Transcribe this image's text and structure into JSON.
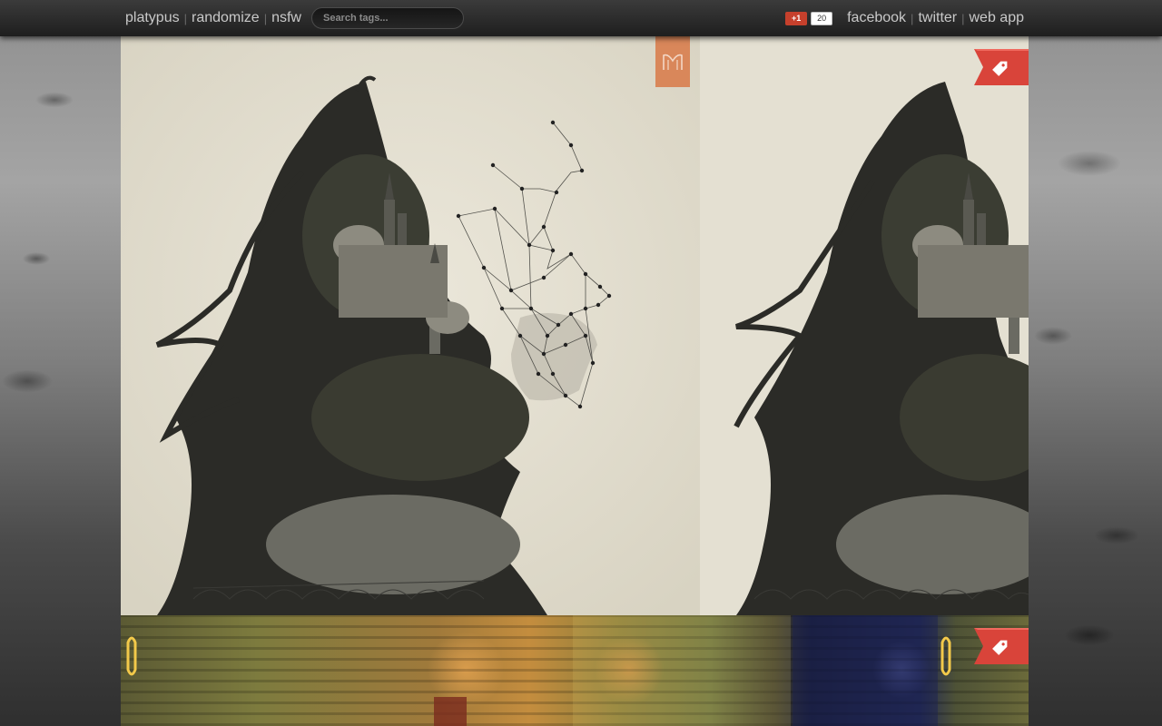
{
  "nav": {
    "brand": "platypus",
    "randomize": "randomize",
    "nsfw": "nsfw",
    "separator": "|",
    "search_placeholder": "Search tags..."
  },
  "social": {
    "gplus_label": "+1",
    "gplus_count": "20",
    "facebook": "facebook",
    "twitter": "twitter",
    "web_app": "web app"
  },
  "icons": {
    "logo": "m-logo-icon",
    "tag": "tag-icon"
  },
  "colors": {
    "accent_orange": "#d9875a",
    "ribbon_red": "#d9443a",
    "gplus_red": "#c6402c",
    "topbar": "#2a2a2a",
    "paper": "#e5e1d3"
  }
}
